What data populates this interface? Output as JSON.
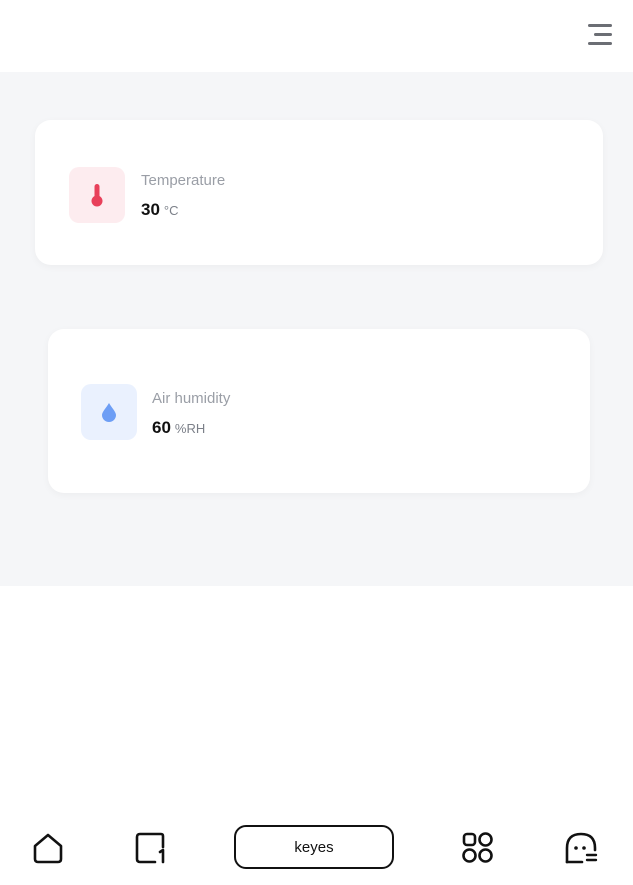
{
  "header": {
    "menu_icon": "hamburger-menu-icon"
  },
  "sensors": [
    {
      "label": "Temperature",
      "value": "30",
      "unit": "°C",
      "icon": "thermometer-icon",
      "accent": "#e8405a",
      "icon_bg": "#fdecef"
    },
    {
      "label": "Air humidity",
      "value": "60",
      "unit": "%RH",
      "icon": "water-drop-icon",
      "accent": "#6d9ef5",
      "icon_bg": "#eaf1fe"
    }
  ],
  "bottom_nav": {
    "items": [
      {
        "icon": "home-icon"
      },
      {
        "icon": "page-icon"
      },
      {
        "label": "keyes"
      },
      {
        "icon": "apps-grid-icon"
      },
      {
        "icon": "profile-icon"
      }
    ]
  },
  "colors": {
    "page_bg": "#f5f6f8",
    "card_bg": "#ffffff",
    "text_dark": "#111111",
    "text_muted": "#9a9ea6"
  }
}
